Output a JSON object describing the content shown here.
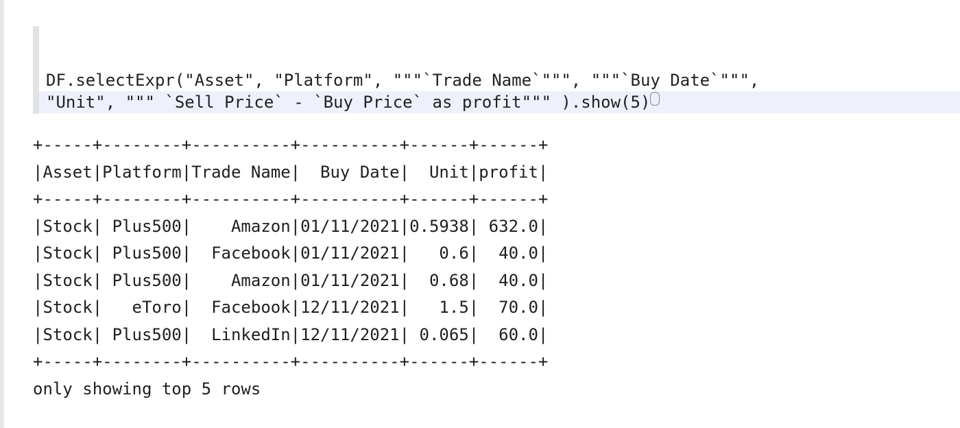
{
  "code_cell": {
    "lines": [
      "DF.selectExpr(\"Asset\", \"Platform\", \"\"\"`Trade Name`\"\"\", \"\"\"`Buy Date`\"\"\",",
      "\"Unit\", \"\"\" `Sell Price` - `Buy Price` as profit\"\"\" ).show(5)"
    ]
  },
  "output": {
    "lines": [
      "+-----+--------+----------+----------+------+------+",
      "|Asset|Platform|Trade Name|  Buy Date|  Unit|profit|",
      "+-----+--------+----------+----------+------+------+",
      "|Stock| Plus500|    Amazon|01/11/2021|0.5938| 632.0|",
      "|Stock| Plus500|  Facebook|01/11/2021|   0.6|  40.0|",
      "|Stock| Plus500|    Amazon|01/11/2021|  0.68|  40.0|",
      "|Stock|   eToro|  Facebook|12/11/2021|   1.5|  70.0|",
      "|Stock| Plus500|  LinkedIn|12/11/2021| 0.065|  60.0|",
      "+-----+--------+----------+----------+------+------+",
      "only showing top 5 rows"
    ]
  }
}
